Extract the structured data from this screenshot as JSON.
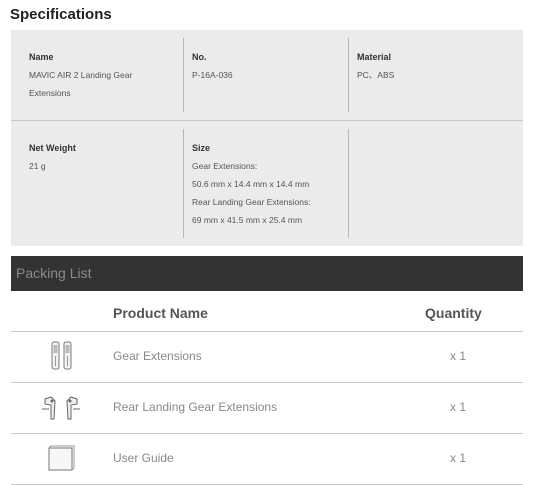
{
  "specifications": {
    "title": "Specifications",
    "rows": [
      [
        {
          "label": "Name",
          "lines": [
            "MAVIC AIR 2 Landing Gear",
            "Extensions"
          ]
        },
        {
          "label": "No.",
          "lines": [
            "P-16A-036"
          ]
        },
        {
          "label": "Material",
          "lines": [
            "PC、ABS"
          ]
        }
      ],
      [
        {
          "label": "Net Weight",
          "lines": [
            "21 g"
          ]
        },
        {
          "label": "Size",
          "lines": [
            "Gear Extensions:",
            "50.6 mm x 14.4 mm x 14.4 mm",
            "Rear Landing Gear Extensions:",
            "69 mm x 41.5 mm x 25.4 mm"
          ]
        },
        {
          "label": "",
          "lines": []
        }
      ]
    ]
  },
  "packing_list": {
    "title": "Packing List",
    "columns": {
      "product": "Product Name",
      "quantity": "Quantity"
    },
    "items": [
      {
        "name": "Gear Extensions",
        "quantity": "x 1",
        "icon": "gear-extensions-icon"
      },
      {
        "name": "Rear Landing Gear Extensions",
        "quantity": "x 1",
        "icon": "rear-landing-gear-icon"
      },
      {
        "name": "User Guide",
        "quantity": "x 1",
        "icon": "user-guide-icon"
      }
    ]
  }
}
